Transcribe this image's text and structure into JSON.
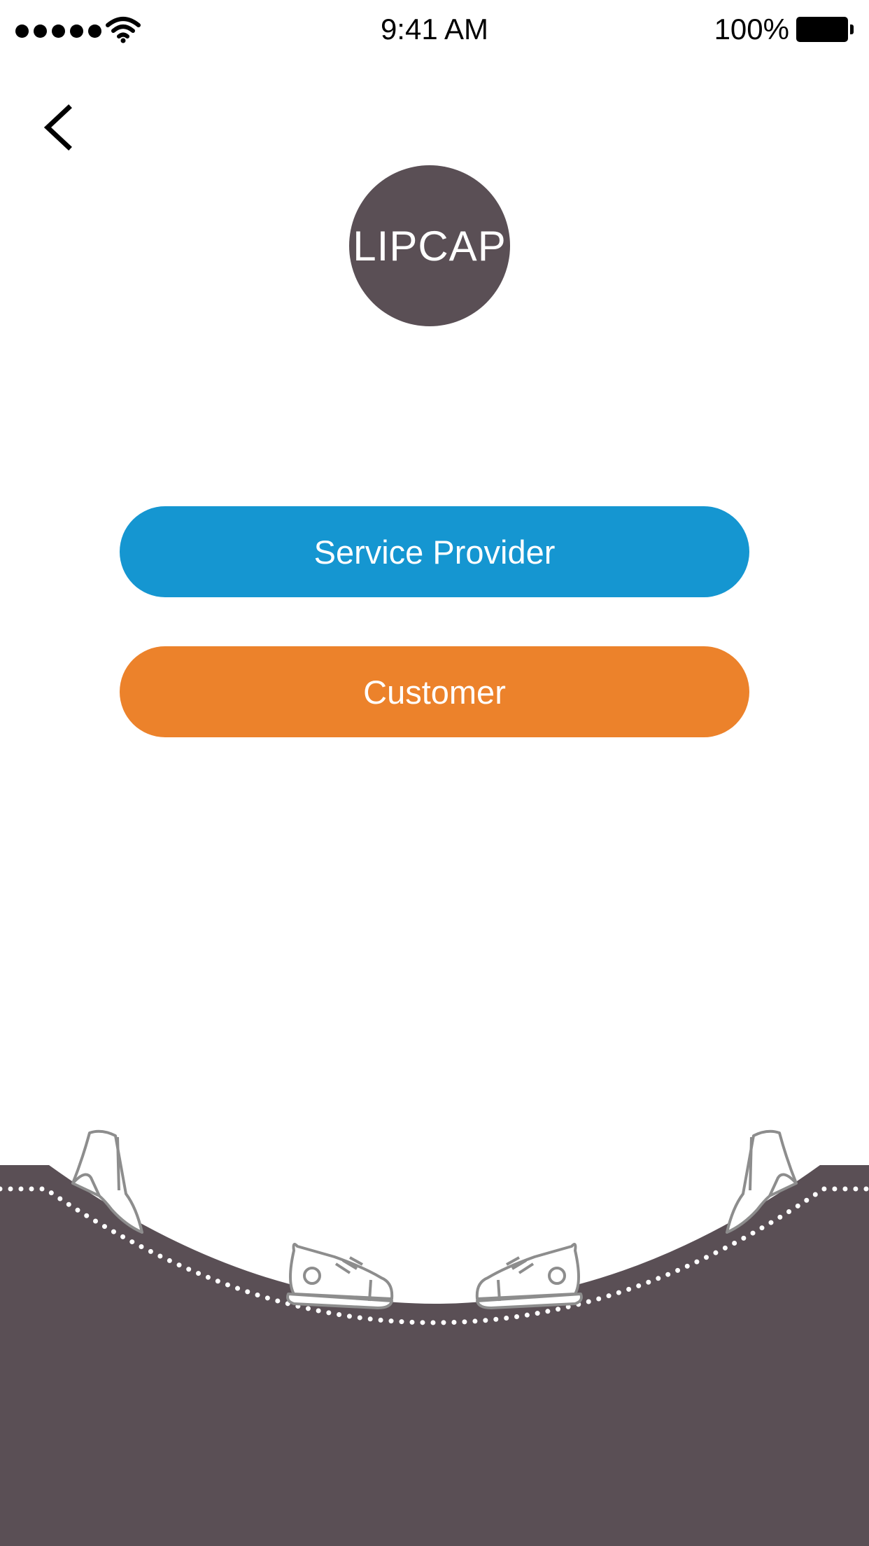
{
  "status_bar": {
    "time": "9:41 AM",
    "battery_percent": "100%",
    "signal_bars": 5,
    "icons": [
      "signal-dots-icon",
      "wifi-icon",
      "battery-icon"
    ]
  },
  "nav": {
    "back_icon": "chevron-left-icon"
  },
  "logo": {
    "text": "LIPCAP",
    "color": "#5a4f55"
  },
  "buttons": {
    "service_provider": {
      "label": "Service Provider",
      "color": "#1596d1"
    },
    "customer": {
      "label": "Customer",
      "color": "#ec822b"
    }
  },
  "footer": {
    "background": "#5a4f55",
    "decorations": [
      "high-heel-icon",
      "sneaker-icon",
      "sneaker-icon",
      "high-heel-icon"
    ]
  }
}
